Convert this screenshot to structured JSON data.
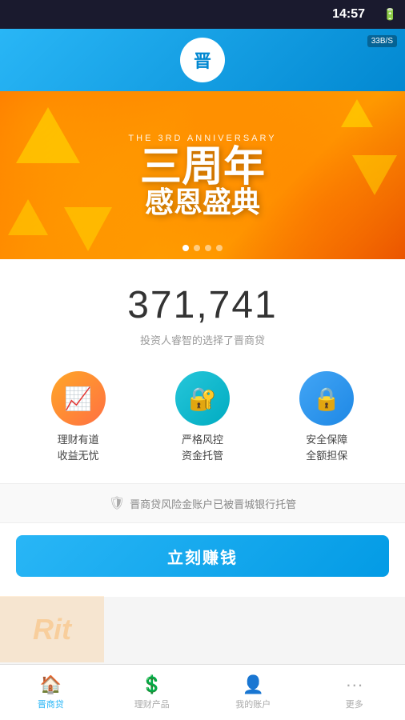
{
  "status": {
    "time": "14:57",
    "battery": "🔋",
    "wifi_speed": "33B/S"
  },
  "header": {
    "logo_text": "晋商贷",
    "logo_initials": "晋"
  },
  "banner": {
    "subtitle": "THE 3RD ANNIVERSARY",
    "title_line1": "三周年",
    "title_line2": "感恩盛典",
    "dots": [
      {
        "active": true
      },
      {
        "active": false
      },
      {
        "active": false
      },
      {
        "active": false
      }
    ]
  },
  "counter": {
    "number": "371,741",
    "description": "投资人睿智的选择了晋商贷"
  },
  "features": [
    {
      "icon": "📈",
      "label_line1": "理财有道",
      "label_line2": "收益无忧",
      "color": "orange"
    },
    {
      "icon": "🔐",
      "label_line1": "严格风控",
      "label_line2": "资金托管",
      "color": "teal"
    },
    {
      "icon": "🔒",
      "label_line1": "安全保障",
      "label_line2": "全额担保",
      "color": "blue"
    }
  ],
  "trust": {
    "icon": "🛡",
    "text": "晋商贷风险金账户已被晋城银行托管"
  },
  "cta": {
    "label": "立刻赚钱"
  },
  "nav": {
    "items": [
      {
        "label": "晋商贷",
        "icon": "🏠",
        "active": true
      },
      {
        "label": "理财产品",
        "icon": "💲",
        "active": false
      },
      {
        "label": "我的账户",
        "icon": "👤",
        "active": false
      },
      {
        "label": "更多",
        "icon": "···",
        "active": false
      }
    ]
  },
  "watermark": {
    "text": "Rit"
  }
}
